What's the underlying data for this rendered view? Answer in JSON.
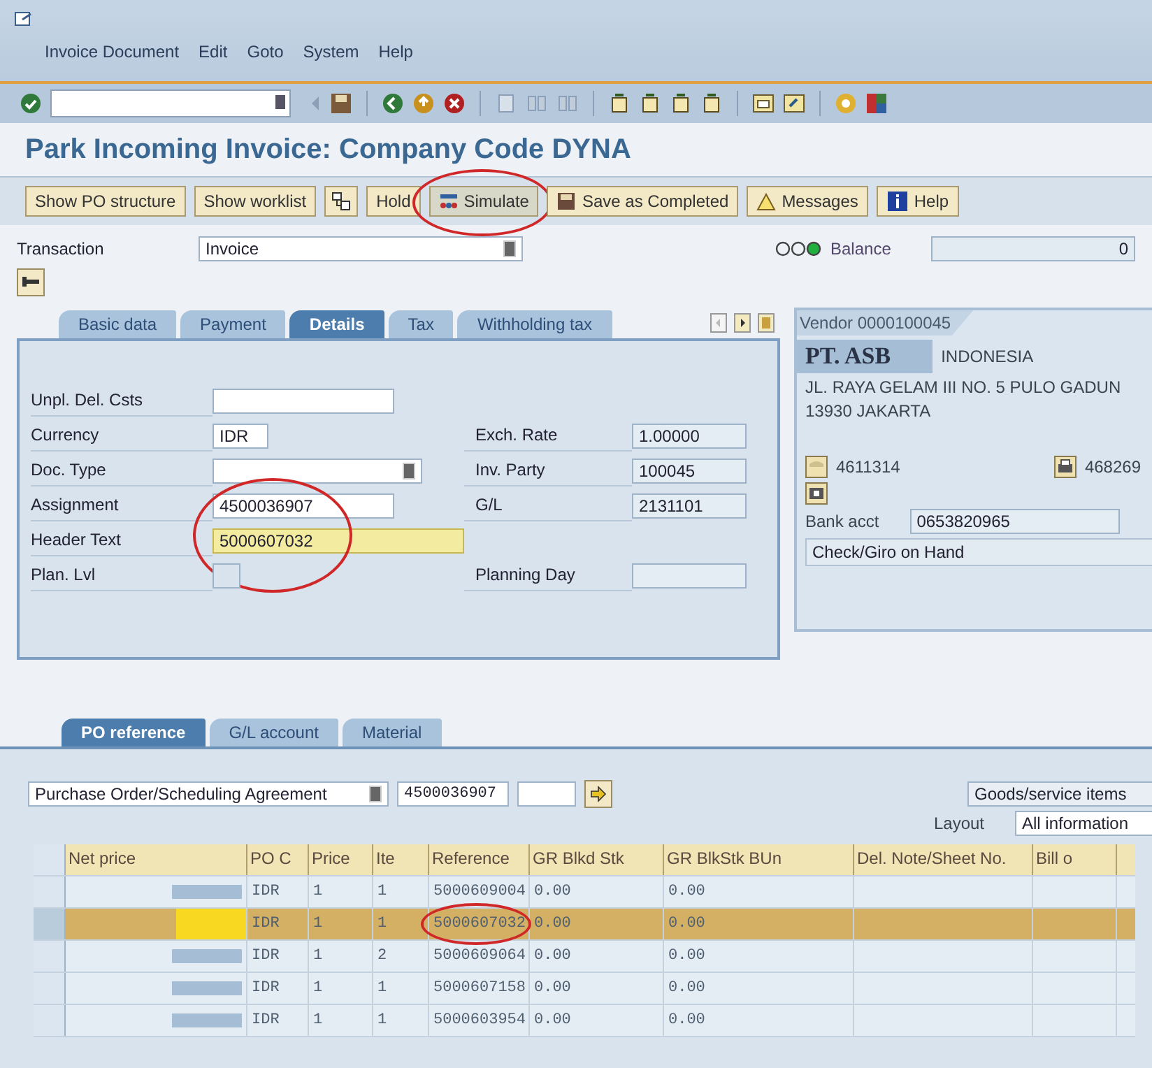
{
  "menu_bar": [
    "Invoice Document",
    "Edit",
    "Goto",
    "System",
    "Help"
  ],
  "title": "Park Incoming Invoice: Company Code DYNA",
  "app_toolbar": [
    {
      "kind": "text",
      "label": "Show PO structure",
      "circled": false
    },
    {
      "kind": "text",
      "label": "Show worklist",
      "circled": false
    },
    {
      "kind": "tree",
      "circled": false
    },
    {
      "kind": "text",
      "label": "Hold",
      "circled": false
    },
    {
      "kind": "simulate",
      "label": "Simulate",
      "circled": true
    },
    {
      "kind": "save",
      "label": "Save as Completed",
      "circled": false
    },
    {
      "kind": "warning",
      "label": "Messages",
      "circled": false
    },
    {
      "kind": "info",
      "label": "Help",
      "circled": false
    }
  ],
  "transaction": {
    "label": "Transaction",
    "value": "Invoice"
  },
  "balance": {
    "label": "Balance",
    "value": "0"
  },
  "header_tabs": [
    {
      "label": "Basic data",
      "selected": false
    },
    {
      "label": "Payment",
      "selected": false
    },
    {
      "label": "Details",
      "selected": true
    },
    {
      "label": "Tax",
      "selected": false
    },
    {
      "label": "Withholding tax",
      "selected": false
    }
  ],
  "details_left": [
    {
      "label": "Unpl. Del. Csts",
      "kind": "input",
      "circled": false,
      "focused": false
    },
    {
      "label": "Currency",
      "kind": "short",
      "value": "IDR",
      "circled": false,
      "focused": false
    },
    {
      "label": "Doc. Type",
      "kind": "dropdown",
      "circled": false,
      "focused": false
    },
    {
      "label": "Assignment",
      "kind": "input",
      "value": "4500036907",
      "circled": false,
      "focused": false
    },
    {
      "label": "Header Text",
      "kind": "input",
      "value": "5000607032",
      "circled": true,
      "focused": true
    },
    {
      "label": "Plan. Lvl",
      "kind": "tiny",
      "circled": false,
      "focused": false
    }
  ],
  "details_right": [
    {
      "label": "Exch. Rate",
      "value": "1.00000"
    },
    {
      "label": "Inv. Party",
      "value": "100045"
    },
    {
      "label": "G/L",
      "value": "2131101"
    },
    {
      "label": "Planning Day"
    }
  ],
  "vendor": {
    "title": "Vendor 0000100045",
    "name": "PT. ASB",
    "name_rest": "INDONESIA",
    "street": "JL. RAYA GELAM III NO. 5 PULO GADUN",
    "city": "13930 JAKARTA",
    "phone": "4611314",
    "fax": "468269",
    "bank_label": "Bank acct",
    "bank_value": "0653820965",
    "payment": "Check/Giro on Hand"
  },
  "item_tabs": [
    {
      "label": "PO reference",
      "selected": true
    },
    {
      "label": "G/L account",
      "selected": false
    },
    {
      "label": "Material",
      "selected": false
    }
  ],
  "po_reference": {
    "doc_type": "Purchase Order/Scheduling Agreement",
    "number": "4500036907",
    "goods": "Goods/service items",
    "layout_label": "Layout",
    "layout_value": "All information"
  },
  "table": {
    "columns": [
      "Net price",
      "PO C",
      "Price",
      "Ite",
      "Reference",
      "GR Blkd Stk",
      "GR BlkStk BUn",
      "Del. Note/Sheet No.",
      "Bill o"
    ],
    "rows": [
      {
        "selected": false,
        "circled": false,
        "cells": [
          "",
          "IDR",
          "1",
          "1",
          "5000609004",
          "0.00",
          "0.00",
          "",
          ""
        ]
      },
      {
        "selected": true,
        "circled": true,
        "cells": [
          "",
          "IDR",
          "1",
          "1",
          "5000607032",
          "0.00",
          "0.00",
          "",
          ""
        ]
      },
      {
        "selected": false,
        "circled": false,
        "cells": [
          "",
          "IDR",
          "1",
          "2",
          "5000609064",
          "0.00",
          "0.00",
          "",
          ""
        ]
      },
      {
        "selected": false,
        "circled": false,
        "cells": [
          "",
          "IDR",
          "1",
          "1",
          "5000607158",
          "0.00",
          "0.00",
          "",
          ""
        ]
      },
      {
        "selected": false,
        "circled": false,
        "cells": [
          "",
          "IDR",
          "1",
          "1",
          "5000603954",
          "0.00",
          "0.00",
          "",
          ""
        ]
      }
    ]
  }
}
